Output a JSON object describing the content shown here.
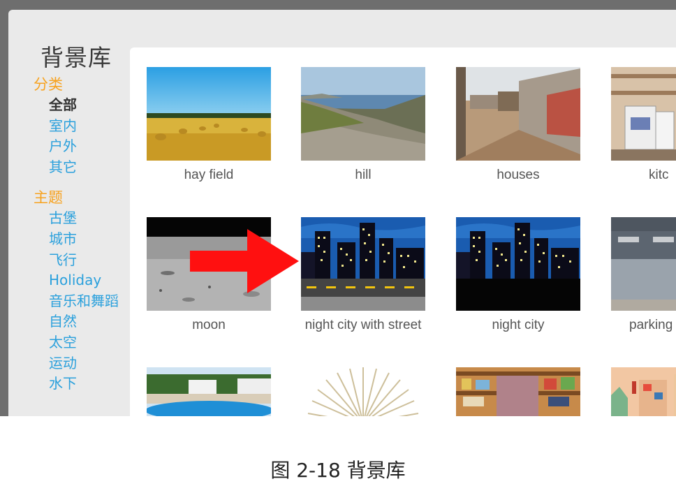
{
  "window": {
    "title": "背景库"
  },
  "sidebar": {
    "categories": [
      {
        "label": "分类",
        "items": [
          {
            "label": "全部",
            "selected": true
          },
          {
            "label": "室内",
            "selected": false
          },
          {
            "label": "户外",
            "selected": false
          },
          {
            "label": "其它",
            "selected": false
          }
        ]
      },
      {
        "label": "主题",
        "items": [
          {
            "label": "古堡",
            "selected": false
          },
          {
            "label": "城市",
            "selected": false
          },
          {
            "label": "飞行",
            "selected": false
          },
          {
            "label": "Holiday",
            "selected": false
          },
          {
            "label": "音乐和舞蹈",
            "selected": false
          },
          {
            "label": "自然",
            "selected": false
          },
          {
            "label": "太空",
            "selected": false
          },
          {
            "label": "运动",
            "selected": false
          },
          {
            "label": "水下",
            "selected": false
          }
        ]
      }
    ]
  },
  "library": {
    "row1": [
      "hay field",
      "hill",
      "houses",
      "kitc"
    ],
    "row2": [
      "moon",
      "night city with street",
      "night city",
      "parking"
    ]
  },
  "annotation": {
    "arrow_color": "#ff1010"
  },
  "caption": "图 2-18  背景库"
}
